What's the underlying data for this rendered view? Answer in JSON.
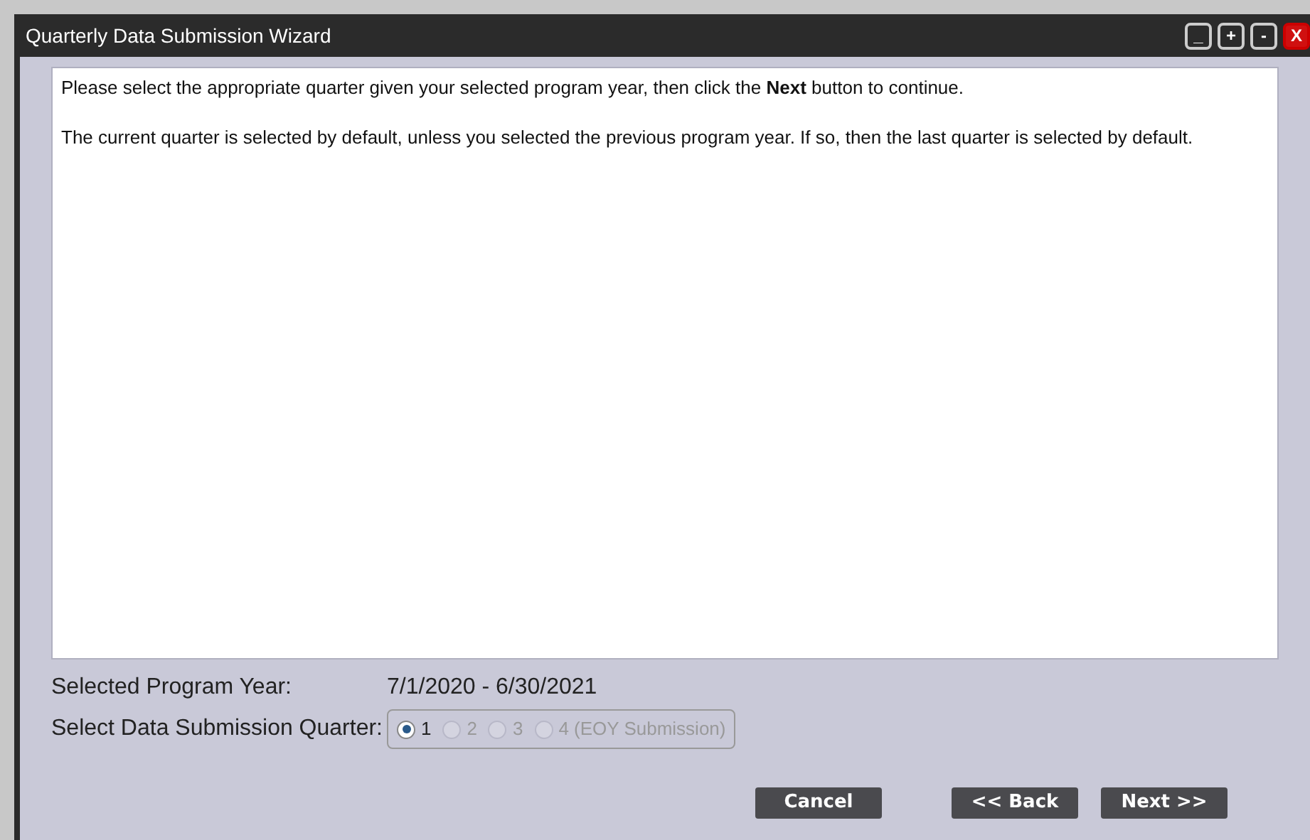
{
  "window": {
    "title": "Quarterly Data Submission Wizard",
    "controls": [
      {
        "kind": "minimize",
        "label": "_"
      },
      {
        "kind": "plus",
        "label": "+"
      },
      {
        "kind": "minus",
        "label": "-"
      },
      {
        "kind": "close",
        "label": "X"
      }
    ]
  },
  "instructions": [
    "Please select the appropriate quarter given your selected program year, then click the **Next** button to continue.",
    "The current quarter is selected by default, unless you selected the previous program year. If so, then the last quarter is selected by default."
  ],
  "program_year": {
    "label": "Selected Program Year:",
    "value": "7/1/2020 - 6/30/2021"
  },
  "quarter": {
    "label": "Select Data Submission Quarter:",
    "options": [
      {
        "label": "1",
        "selected": true,
        "disabled": false
      },
      {
        "label": "2",
        "selected": false,
        "disabled": true
      },
      {
        "label": "3",
        "selected": false,
        "disabled": true
      },
      {
        "label": "4 (EOY Submission)",
        "selected": false,
        "disabled": true
      }
    ]
  },
  "buttons": [
    "Cancel",
    "<< Back",
    "Next >>"
  ]
}
